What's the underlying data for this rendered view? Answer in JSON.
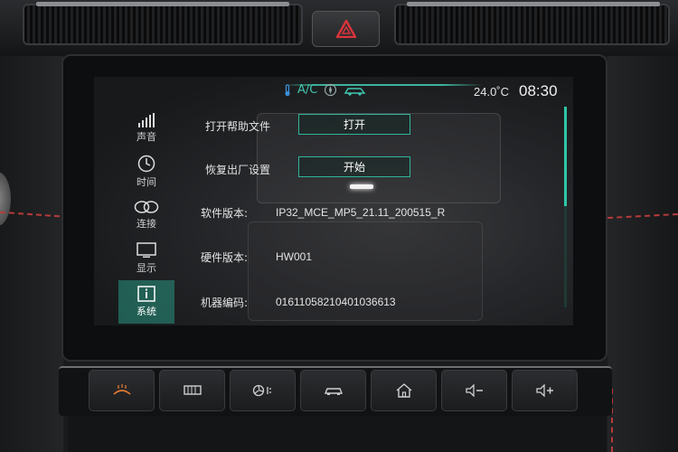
{
  "status_bar": {
    "ac_label": "A/C",
    "temperature": "24.0˚C",
    "time": "08:30",
    "icons": [
      "thermometer-icon",
      "fan-recirculate-icon",
      "car-airflow-icon"
    ]
  },
  "sidebar": {
    "items": [
      {
        "label": "声音",
        "icon": "signal-bars-icon",
        "active": false
      },
      {
        "label": "时间",
        "icon": "clock-icon",
        "active": false
      },
      {
        "label": "连接",
        "icon": "link-icon",
        "active": false
      },
      {
        "label": "显示",
        "icon": "monitor-icon",
        "active": false
      },
      {
        "label": "系统",
        "icon": "info-icon",
        "active": true
      }
    ]
  },
  "settings": {
    "help_label": "打开帮助文件",
    "help_button": "打开",
    "reset_label": "恢复出厂设置",
    "reset_button": "开始",
    "software_label": "软件版本:",
    "software_value": "IP32_MCE_MP5_21.11_200515_R",
    "hardware_label": "硬件版本:",
    "hardware_value": "HW001",
    "serial_label": "机器编码:",
    "serial_value": "01611058210401036613"
  },
  "hardware_buttons": [
    "front-defrost-icon",
    "rear-defrost-icon",
    "fan-icon",
    "car-icon",
    "home-icon",
    "volume-down-icon",
    "volume-up-icon"
  ],
  "colors": {
    "accent": "#2fb59c",
    "active_tab": "#289682",
    "defrost_orange": "#e2792f",
    "hazard_red": "#d8343a"
  }
}
